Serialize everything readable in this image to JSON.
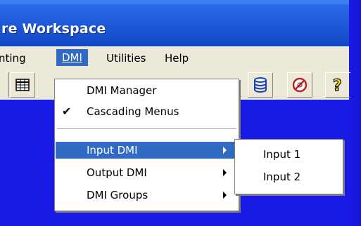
{
  "window": {
    "title": "re Workspace"
  },
  "menubar": {
    "items": [
      {
        "label": "nting"
      },
      {
        "label": "DMI"
      },
      {
        "label": "Utilities"
      },
      {
        "label": "Help"
      }
    ]
  },
  "toolbar": {
    "buttons": [
      {
        "icon": "table-grid-icon"
      },
      {
        "icon": "database-icon"
      },
      {
        "icon": "no-entry-icon"
      },
      {
        "icon": "help-question-icon"
      }
    ]
  },
  "dmi_menu": {
    "items": [
      {
        "label": "DMI Manager",
        "checked": false,
        "submenu": false
      },
      {
        "label": "Cascading Menus",
        "checked": true,
        "submenu": false
      },
      {
        "label": "Input DMI",
        "checked": false,
        "submenu": true,
        "selected": true
      },
      {
        "label": "Output DMI",
        "checked": false,
        "submenu": true
      },
      {
        "label": "DMI Groups",
        "checked": false,
        "submenu": true
      }
    ]
  },
  "input_dmi_submenu": {
    "items": [
      {
        "label": "Input 1"
      },
      {
        "label": "Input 2"
      }
    ]
  },
  "colors": {
    "desktop_blue": "#1a1ae6",
    "titlebar_blue": "#1e5ad8",
    "menu_highlight": "#316ac5",
    "face": "#ece9d8"
  }
}
